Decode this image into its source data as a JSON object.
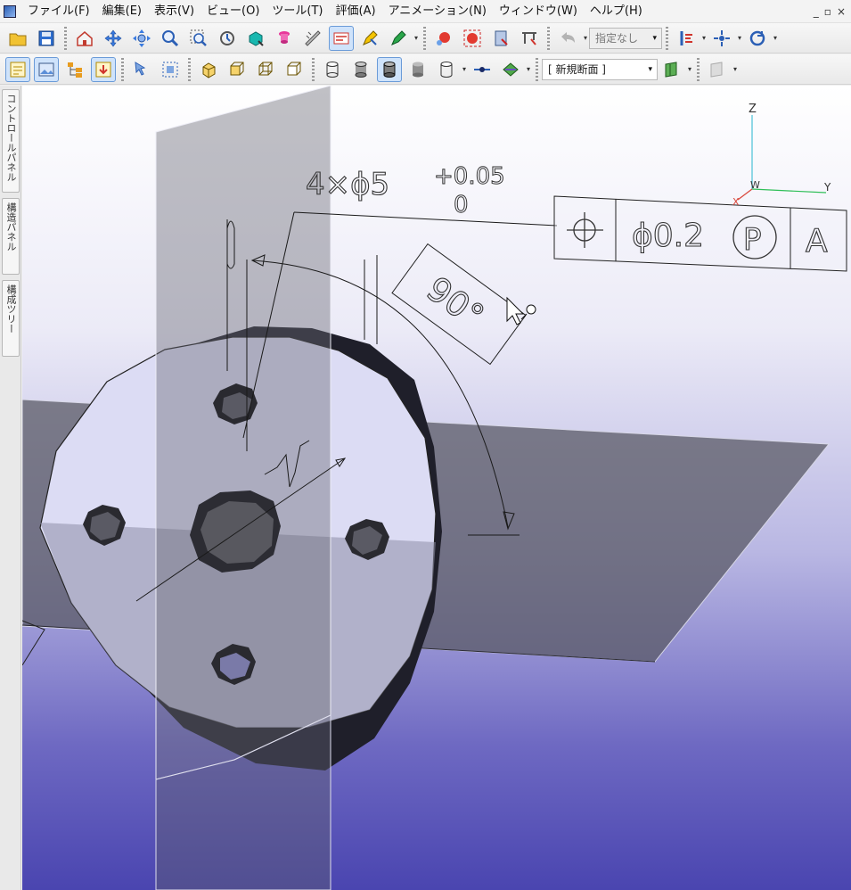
{
  "menu": {
    "items": [
      "ファイル(F)",
      "編集(E)",
      "表示(V)",
      "ビュー(O)",
      "ツール(T)",
      "評価(A)",
      "アニメーション(N)",
      "ウィンドウ(W)",
      "ヘルプ(H)"
    ],
    "window_controls": [
      "_",
      "▫",
      "×"
    ]
  },
  "toolbar": {
    "view_select": "指定なし",
    "section_select": "[ 新規断面 ]"
  },
  "side_tabs": {
    "control_panel": "コントロールパネル",
    "annotation_panel": "構造パネル",
    "structure_tree": "構成ツリー"
  },
  "viewport": {
    "axis_labels": {
      "z": "Z",
      "x": "X",
      "y": "Y",
      "w": "W"
    },
    "dimension_main": "4×ϕ5",
    "dimension_upper_tol": "+0.05",
    "dimension_lower_tol": "0",
    "angle_label": "90°",
    "fcf_tolerance": "ϕ0.2",
    "fcf_modifier": "P",
    "fcf_datum": "A"
  }
}
